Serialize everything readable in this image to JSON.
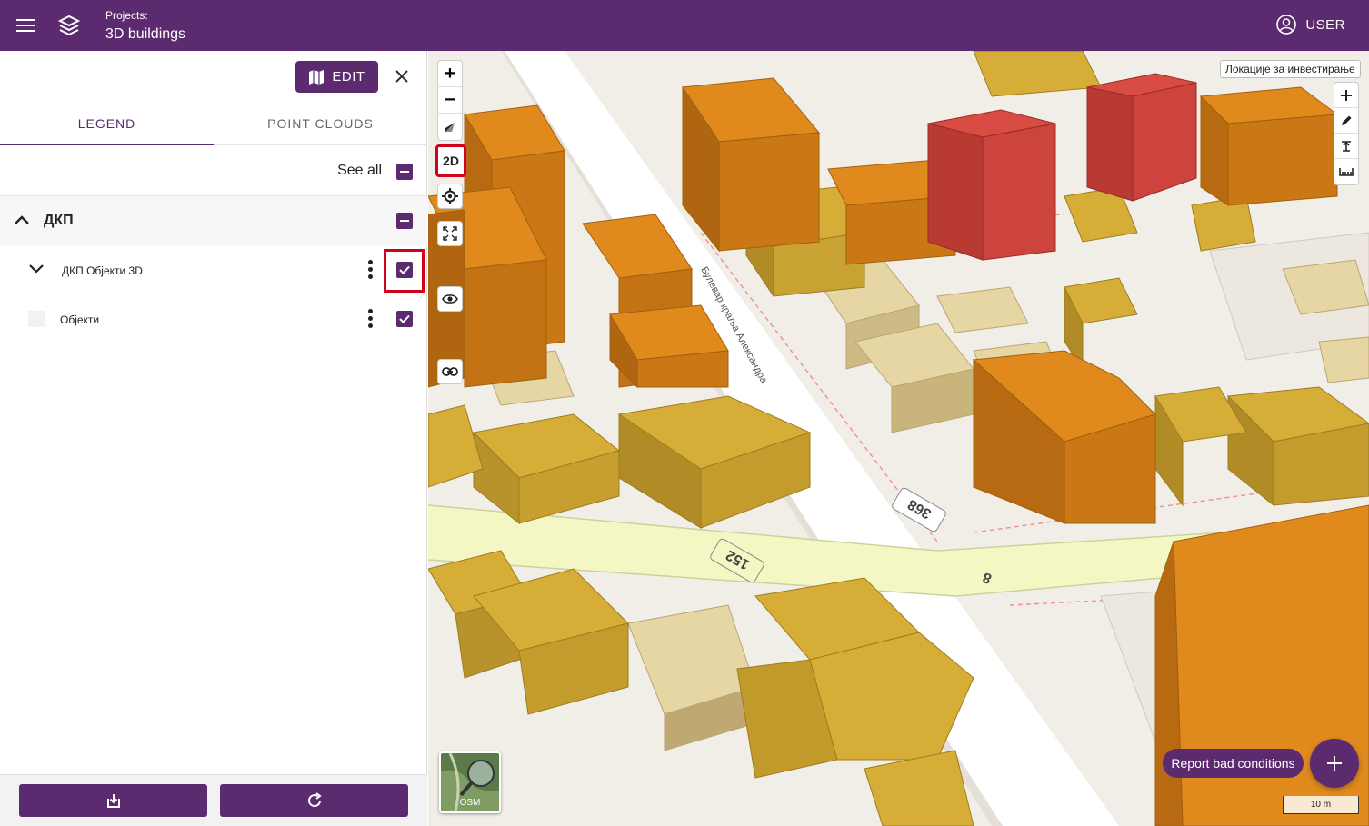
{
  "header": {
    "projects_label": "Projects:",
    "project_title": "3D buildings",
    "user_label": "USER"
  },
  "panel": {
    "edit_label": "EDIT",
    "tabs": [
      {
        "label": "LEGEND",
        "active": true
      },
      {
        "label": "POINT CLOUDS",
        "active": false
      }
    ],
    "see_all_label": "See all",
    "group": {
      "title": "ДКП",
      "expanded": true
    },
    "layers": [
      {
        "name": "ДКП Објекти 3D",
        "checked": true,
        "expandable": true
      },
      {
        "name": "Објекти",
        "checked": true,
        "expandable": false
      }
    ],
    "footer_buttons": [
      "download-icon",
      "refresh-icon"
    ]
  },
  "map": {
    "controls_left": [
      "zoom-in",
      "zoom-out",
      "compass",
      "2D",
      "locate",
      "fullscreen",
      "visibility",
      "link"
    ],
    "mode_button_label": "2D",
    "layer_tooltip": "Локације за инвестирање",
    "controls_right": [
      "plus-icon",
      "pencil-icon",
      "pin-icon",
      "ruler-icon"
    ],
    "report_button_label": "Report bad conditions",
    "basemap_label": "OSM",
    "scale_label": "10 m",
    "road_labels": [
      "368",
      "152",
      "8"
    ],
    "street_name": "Булевар краља Александра",
    "colors": {
      "accent": "#5c2a6e",
      "highlight": "#d0021b",
      "building_tall": "#e08a1e",
      "building_mid": "#d6ad36",
      "building_low": "#e6d6a4",
      "building_red": "#d94c44"
    }
  }
}
